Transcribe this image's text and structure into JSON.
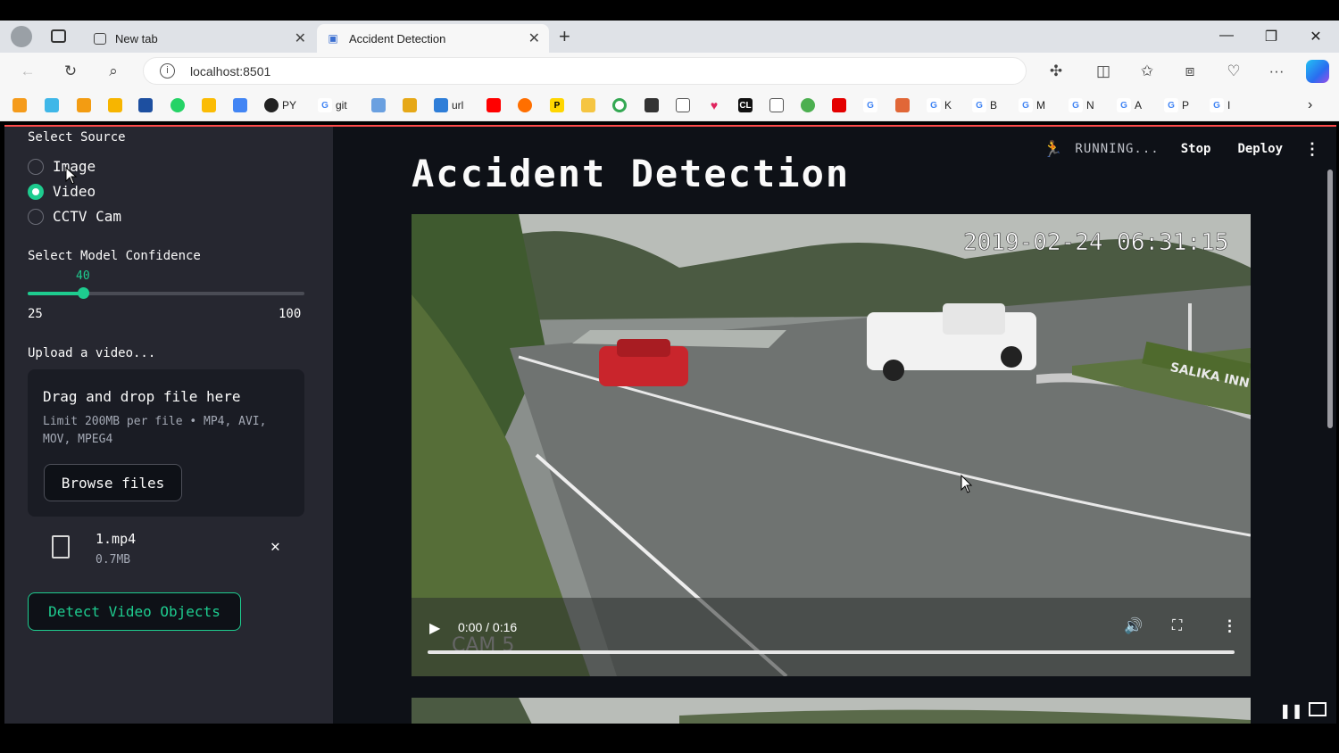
{
  "browser": {
    "tabs": [
      {
        "label": "New tab",
        "active": false
      },
      {
        "label": "Accident Detection",
        "active": true
      }
    ],
    "url": "localhost:8501",
    "bookmarks": [
      {
        "icon": "py-bookmark-icon",
        "label": "PY"
      },
      {
        "icon": "google-icon",
        "label": "git"
      },
      {
        "icon": "link-icon",
        "label": "url"
      },
      {
        "icon": "google-icon",
        "label": "K"
      },
      {
        "icon": "google-icon",
        "label": "B"
      },
      {
        "icon": "google-icon",
        "label": "M"
      },
      {
        "icon": "google-icon",
        "label": "N"
      },
      {
        "icon": "google-icon",
        "label": "A"
      },
      {
        "icon": "google-icon",
        "label": "P"
      },
      {
        "icon": "google-icon",
        "label": "I"
      }
    ]
  },
  "sidebar": {
    "source_label": "Select Source",
    "sources": [
      {
        "label": "Image",
        "selected": false
      },
      {
        "label": "Video",
        "selected": true
      },
      {
        "label": "CCTV Cam",
        "selected": false
      }
    ],
    "confidence_label": "Select Model Confidence",
    "confidence_value": "40",
    "confidence_fraction": 0.2,
    "confidence_min": "25",
    "confidence_max": "100",
    "upload_label": "Upload a video...",
    "dropzone_title": "Drag and drop file here",
    "dropzone_limit": "Limit 200MB per file • MP4, AVI, MOV, MPEG4",
    "browse_label": "Browse files",
    "file_name": "1.mp4",
    "file_size": "0.7MB",
    "detect_label": "Detect Video Objects"
  },
  "header": {
    "status": "RUNNING...",
    "stop_label": "Stop",
    "deploy_label": "Deploy"
  },
  "main": {
    "title": "Accident Detection",
    "video": {
      "timestamp": "2019-02-24  06:31:15",
      "cam_label": "CAM 5",
      "sign_text": "SALIKA INN",
      "time_display": "0:00 / 0:16"
    }
  },
  "colors": {
    "accent": "#1ecc8f",
    "sidebar_bg": "#262730",
    "main_bg": "#0e1117"
  }
}
